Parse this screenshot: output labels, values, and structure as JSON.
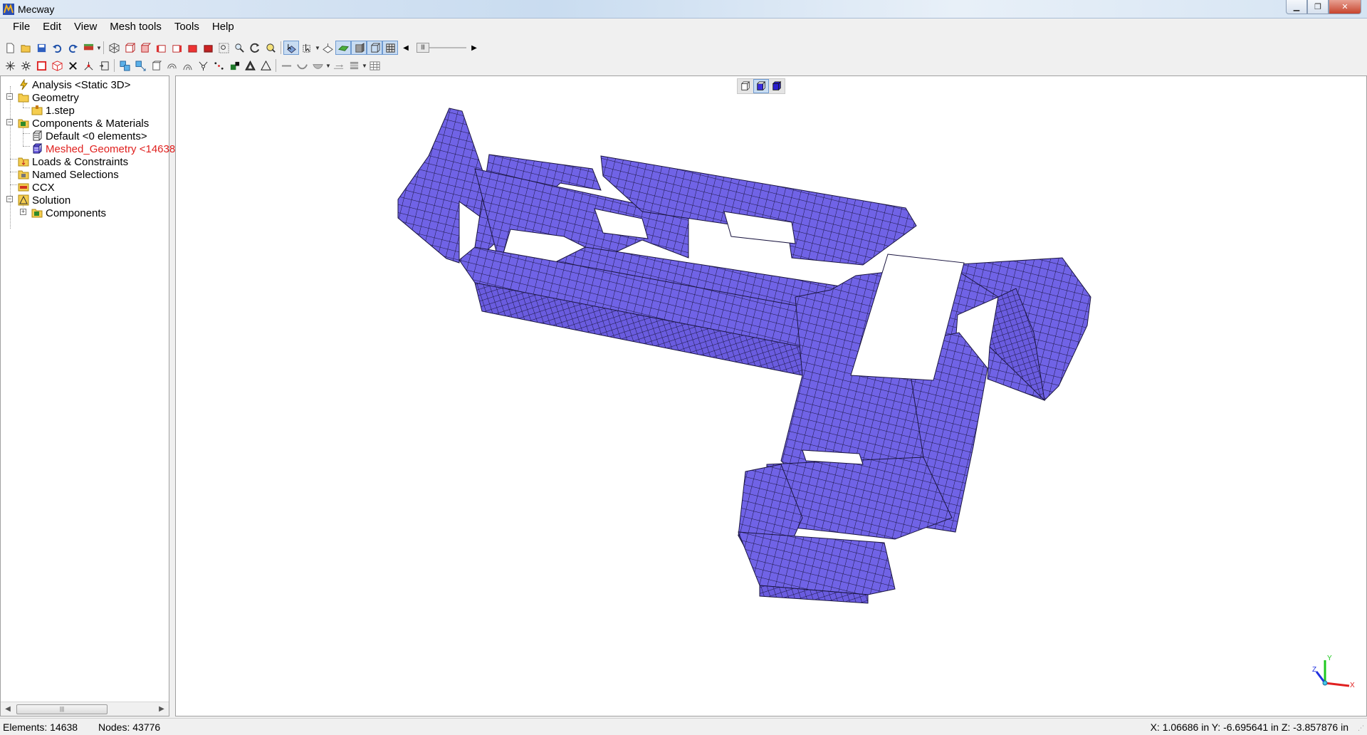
{
  "app": {
    "title": "Mecway"
  },
  "menu": {
    "items": [
      "File",
      "Edit",
      "View",
      "Mesh tools",
      "Tools",
      "Help"
    ]
  },
  "tree": {
    "analysis": "Analysis <Static 3D>",
    "geometry": "Geometry",
    "step_file": "1.step",
    "components_materials": "Components & Materials",
    "default_component": "Default <0 elements>",
    "meshed_geometry": "Meshed_Geometry <14638",
    "loads_constraints": "Loads & Constraints",
    "named_selections": "Named Selections",
    "ccx": "CCX",
    "solution": "Solution",
    "solution_components": "Components"
  },
  "viewport": {
    "mesh_color": "#7063e6",
    "mesh_line_color": "#1a1540",
    "axis": {
      "x": "X",
      "y": "Y",
      "z": "Z"
    }
  },
  "status": {
    "elements": "Elements:  14638",
    "nodes": "Nodes: 43776",
    "coordinates": "X: 1.06686 in Y: -6.695641 in Z: -3.857876 in"
  },
  "colors": {
    "selected_tree_text": "#e0201e",
    "pressed_button": "#c8dcf2"
  }
}
